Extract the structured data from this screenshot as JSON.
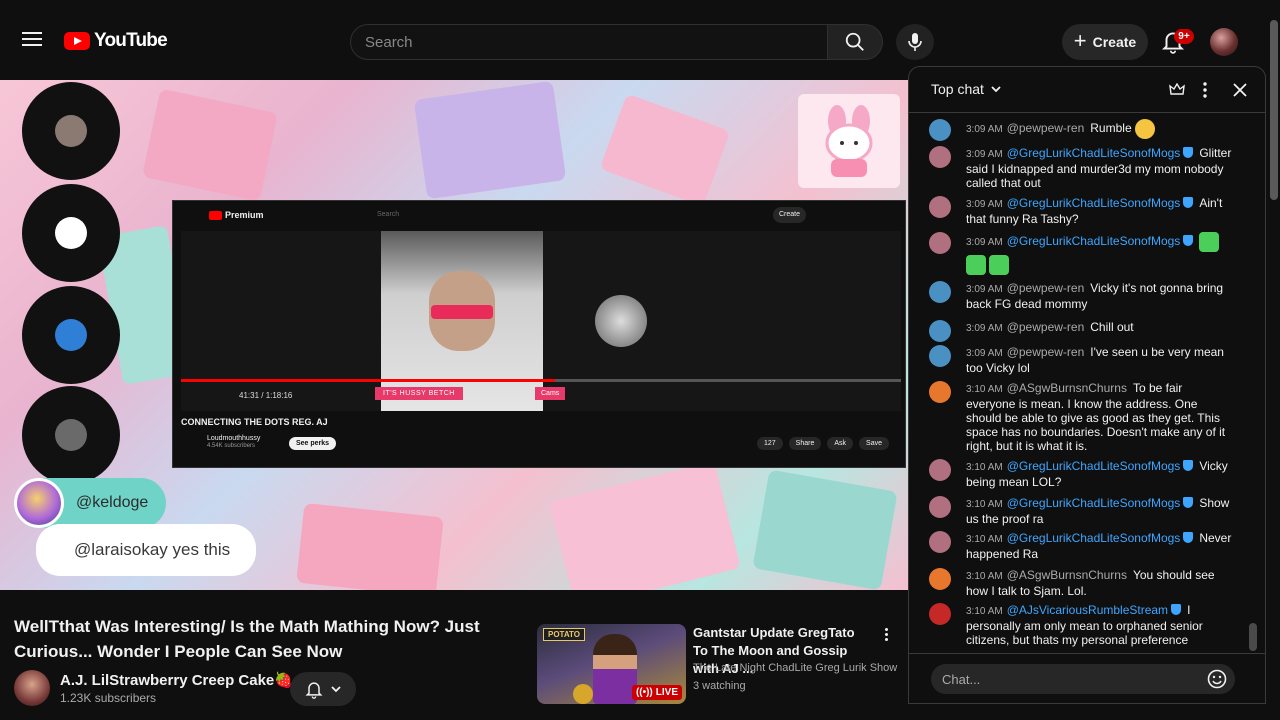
{
  "header": {
    "logo_text": "YouTube",
    "search_placeholder": "Search",
    "create_label": "Create",
    "notification_count": "9+"
  },
  "player": {
    "inner_logo": "Premium",
    "inner_search": "Search",
    "inner_create": "Create",
    "inner_time": "41:31 / 1:18:16",
    "inner_caption_1": "IT'S HUSSY BETCH",
    "inner_caption_2": "Cams",
    "inner_title": "CONNECTING THE DOTS REG. AJ",
    "inner_channel": "Loudmouthhussy",
    "inner_subs": "4.54K subscribers",
    "inner_perks": "See perks",
    "inner_likes": "127",
    "inner_share": "Share",
    "inner_ask": "Ask",
    "inner_save": "Save",
    "overlay_user": "@keldoge",
    "overlay_message": "@laraisokay yes this"
  },
  "video": {
    "title": "WellTthat Was Interesting/ Is the Math Mathing Now? Just Curious... Wonder I People Can See Now",
    "channel_name": "A.J. LilStrawberry Creep Cake🍓",
    "subscribers": "1.23K subscribers"
  },
  "recommendation": {
    "title": "Gantstar Update GregTato To The Moon and Gossip with AJ ...",
    "channel": "The Late Night ChadLite Greg Lurik Show",
    "meta": "3 watching",
    "live_label": "LIVE",
    "thumb_text": "POTATO"
  },
  "chat": {
    "mode_label": "Top chat",
    "input_placeholder": "Chat...",
    "messages": [
      {
        "time": "3:09 AM",
        "author": "@pewpew-ren",
        "text": "Rumble"
      },
      {
        "time": "3:09 AM",
        "author": "@GregLurikChadLiteSonofMogs",
        "text": "Glitter said I kidnapped and murder3d my mom nobody called that out"
      },
      {
        "time": "3:09 AM",
        "author": "@GregLurikChadLiteSonofMogs",
        "text": "Ain't that funny Ra Tashy?"
      },
      {
        "time": "3:09 AM",
        "author": "@GregLurikChadLiteSonofMogs",
        "text": ""
      },
      {
        "time": "3:09 AM",
        "author": "@pewpew-ren",
        "text": "Vicky it's not gonna bring back FG dead mommy"
      },
      {
        "time": "3:09 AM",
        "author": "@pewpew-ren",
        "text": "Chill out"
      },
      {
        "time": "3:09 AM",
        "author": "@pewpew-ren",
        "text": "I've seen u be very mean too Vicky lol"
      },
      {
        "time": "3:10 AM",
        "author": "@ASgwBurnsnChurns",
        "text": "To be fair everyone is mean. I know the address. One should be able to give as good as they get. This space has no boundaries. Doesn't make any of it right, but it is what it is."
      },
      {
        "time": "3:10 AM",
        "author": "@GregLurikChadLiteSonofMogs",
        "text": "Vicky being mean LOL?"
      },
      {
        "time": "3:10 AM",
        "author": "@GregLurikChadLiteSonofMogs",
        "text": "Show us the proof ra"
      },
      {
        "time": "3:10 AM",
        "author": "@GregLurikChadLiteSonofMogs",
        "text": "Never happened Ra"
      },
      {
        "time": "3:10 AM",
        "author": "@ASgwBurnsnChurns",
        "text": "You should see how I talk to Sjam. Lol."
      },
      {
        "time": "3:10 AM",
        "author": "@AJsVicariousRumbleStream",
        "text": "I personally am only mean to orphaned senior citizens, but thats my personal preference"
      }
    ]
  },
  "colors": {
    "accent_red": "#ff0000",
    "moderator_blue": "#3ea6ff",
    "background": "#0f0f0f"
  }
}
